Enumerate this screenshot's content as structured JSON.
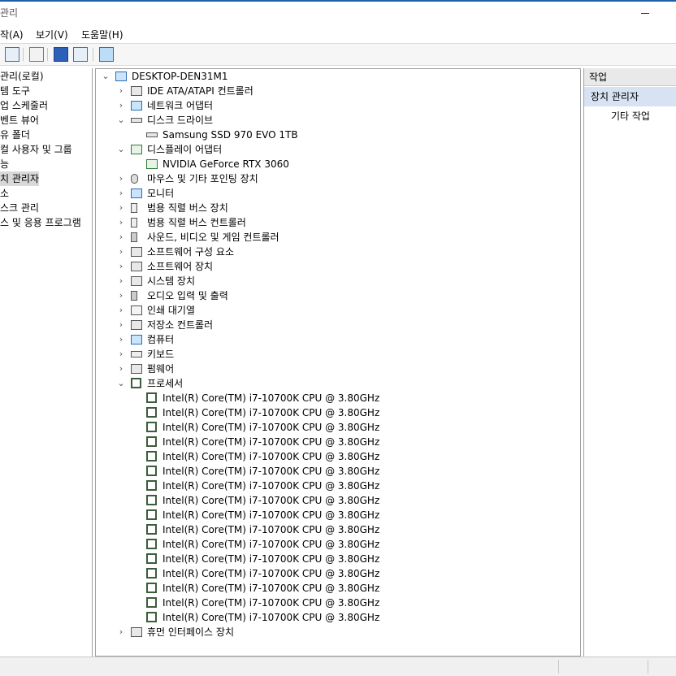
{
  "window": {
    "title": "관리"
  },
  "menu": [
    "작(A)",
    "보기(V)",
    "도움말(H)"
  ],
  "toolbar_icons": [
    "properties-icon",
    "list-icon",
    "help-icon",
    "view-icon",
    "monitor-icon"
  ],
  "left_tree": [
    "관리(로컬)",
    "템 도구",
    "업 스케줄러",
    "벤트 뷰어",
    "유 폴더",
    "컬 사용자 및 그룹",
    "능",
    "치 관리자",
    "소",
    "스크 관리",
    "스 및 응용 프로그램"
  ],
  "left_selected_index": 7,
  "device_tree": {
    "root": "DESKTOP-DEN31M1",
    "nodes": [
      {
        "label": "IDE ATA/ATAPI 컨트롤러",
        "icon": "ide-controller-icon",
        "state": "collapsed"
      },
      {
        "label": "네트워크 어댑터",
        "icon": "network-adapter-icon",
        "state": "collapsed"
      },
      {
        "label": "디스크 드라이브",
        "icon": "disk-drive-icon",
        "state": "expanded",
        "children": [
          "Samsung SSD 970 EVO 1TB"
        ]
      },
      {
        "label": "디스플레이 어댑터",
        "icon": "display-adapter-icon",
        "state": "expanded",
        "children": [
          "NVIDIA GeForce RTX 3060"
        ]
      },
      {
        "label": "마우스 및 기타 포인팅 장치",
        "icon": "mouse-icon",
        "state": "collapsed"
      },
      {
        "label": "모니터",
        "icon": "monitor-icon",
        "state": "collapsed"
      },
      {
        "label": "범용 직렬 버스 장치",
        "icon": "usb-device-icon",
        "state": "collapsed"
      },
      {
        "label": "범용 직렬 버스 컨트롤러",
        "icon": "usb-controller-icon",
        "state": "collapsed"
      },
      {
        "label": "사운드, 비디오 및 게임 컨트롤러",
        "icon": "sound-icon",
        "state": "collapsed"
      },
      {
        "label": "소프트웨어 구성 요소",
        "icon": "software-component-icon",
        "state": "collapsed"
      },
      {
        "label": "소프트웨어 장치",
        "icon": "software-device-icon",
        "state": "collapsed"
      },
      {
        "label": "시스템 장치",
        "icon": "system-device-icon",
        "state": "collapsed"
      },
      {
        "label": "오디오 입력 및 출력",
        "icon": "audio-io-icon",
        "state": "collapsed"
      },
      {
        "label": "인쇄 대기열",
        "icon": "printer-icon",
        "state": "collapsed"
      },
      {
        "label": "저장소 컨트롤러",
        "icon": "storage-controller-icon",
        "state": "collapsed"
      },
      {
        "label": "컴퓨터",
        "icon": "computer-icon",
        "state": "collapsed"
      },
      {
        "label": "키보드",
        "icon": "keyboard-icon",
        "state": "collapsed"
      },
      {
        "label": "펌웨어",
        "icon": "firmware-icon",
        "state": "collapsed"
      },
      {
        "label": "프로세서",
        "icon": "processor-icon",
        "state": "expanded",
        "children": [
          "Intel(R) Core(TM) i7-10700K CPU @ 3.80GHz",
          "Intel(R) Core(TM) i7-10700K CPU @ 3.80GHz",
          "Intel(R) Core(TM) i7-10700K CPU @ 3.80GHz",
          "Intel(R) Core(TM) i7-10700K CPU @ 3.80GHz",
          "Intel(R) Core(TM) i7-10700K CPU @ 3.80GHz",
          "Intel(R) Core(TM) i7-10700K CPU @ 3.80GHz",
          "Intel(R) Core(TM) i7-10700K CPU @ 3.80GHz",
          "Intel(R) Core(TM) i7-10700K CPU @ 3.80GHz",
          "Intel(R) Core(TM) i7-10700K CPU @ 3.80GHz",
          "Intel(R) Core(TM) i7-10700K CPU @ 3.80GHz",
          "Intel(R) Core(TM) i7-10700K CPU @ 3.80GHz",
          "Intel(R) Core(TM) i7-10700K CPU @ 3.80GHz",
          "Intel(R) Core(TM) i7-10700K CPU @ 3.80GHz",
          "Intel(R) Core(TM) i7-10700K CPU @ 3.80GHz",
          "Intel(R) Core(TM) i7-10700K CPU @ 3.80GHz",
          "Intel(R) Core(TM) i7-10700K CPU @ 3.80GHz"
        ]
      },
      {
        "label": "휴먼 인터페이스 장치",
        "icon": "hid-icon",
        "state": "collapsed"
      }
    ]
  },
  "actions": {
    "header": "작업",
    "section": "장치 관리자",
    "more": "기타 작업"
  }
}
